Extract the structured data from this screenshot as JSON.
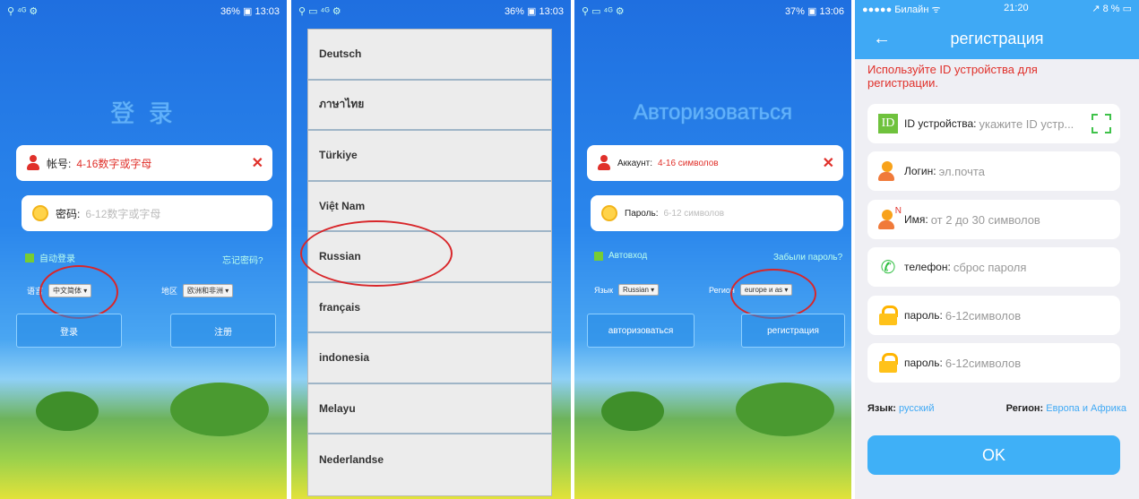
{
  "p1": {
    "status_right": "36% ▣ 13:03",
    "status_net": "3G ⁴ᴳ",
    "title": "登 录",
    "account_label": "帐号:",
    "account_ph": "4-16数字或字母",
    "pwd_label": "密码:",
    "pwd_ph": "6-12数字或字母",
    "autologin": "自动登录",
    "forgot": "忘记密码?",
    "lang_label": "语言",
    "lang_value": "中文简体 ▾",
    "region_label": "地区",
    "region_value": "欧洲和非洲 ▾",
    "login_btn": "登录",
    "register_btn": "注册",
    "close": "✕"
  },
  "p2": {
    "status_right": "36% ▣ 13:03",
    "languages": [
      "Deutsch",
      "ภาษาไทย",
      "Türkiye",
      "Việt Nam",
      "Russian",
      "français",
      "indonesia",
      "Melayu",
      "Nederlandse"
    ]
  },
  "p3": {
    "status_right": "37% ▣ 13:06",
    "title": "Авторизоваться",
    "account_label": "Аккаунт:",
    "account_ph": "4-16 символов",
    "pwd_label": "Пароль:",
    "pwd_ph": "6-12 символов",
    "autologin": "Автовход",
    "forgot": "Забыли пароль?",
    "lang_label": "Язык",
    "lang_value": "Russian ▾",
    "region_label": "Регион",
    "region_value": "europe и as ▾",
    "login_btn": "авторизоваться",
    "register_btn": "регистрация",
    "close": "✕"
  },
  "p4": {
    "carrier": "●●●●● Билайн ᯤ",
    "time": "21:20",
    "battery": "↗ 8 % ▭",
    "back": "←",
    "title": "регистрация",
    "hint": "Используйте ID устройства для регистрации.",
    "id_badge": "ID",
    "id_label": "ID устройства:",
    "id_ph": "укажите ID устр...",
    "login_label": "Логин:",
    "login_ph": "эл.почта",
    "name_label": "Имя:",
    "name_ph": "от 2 до 30 символов",
    "name_mark": "N",
    "phone_label": "телефон:",
    "phone_ph": "сброс пароля",
    "phone_icon": "✆",
    "pwd_label": "пароль:",
    "pwd_ph": "6-12символов",
    "pwd2_label": "пароль:",
    "pwd2_ph": "6-12символов",
    "lang_label": "Язык:",
    "lang_value": "русский",
    "region_label": "Регион:",
    "region_value": "Европа и Африка",
    "ok": "OK"
  }
}
